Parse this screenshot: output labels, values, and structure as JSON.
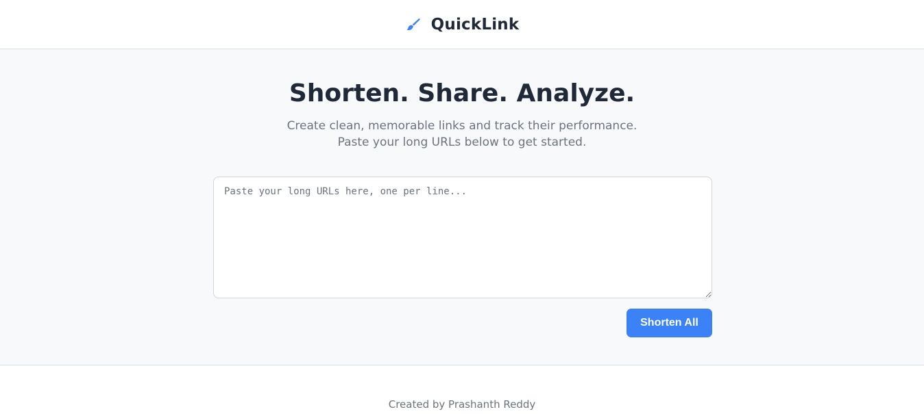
{
  "header": {
    "brand_name": "QuickLink",
    "brand_icon": "pen-brush-icon"
  },
  "hero": {
    "title": "Shorten. Share. Analyze.",
    "subtitle_line1": "Create clean, memorable links and track their performance.",
    "subtitle_line2": "Paste your long URLs below to get started."
  },
  "form": {
    "url_input_value": "",
    "url_input_placeholder": "Paste your long URLs here, one per line...",
    "submit_label": "Shorten All"
  },
  "footer": {
    "credit": "Created by Prashanth Reddy"
  },
  "colors": {
    "accent": "#3b82f6",
    "heading": "#1f2937",
    "muted": "#6b7280",
    "main_bg": "#f8f9fa"
  }
}
